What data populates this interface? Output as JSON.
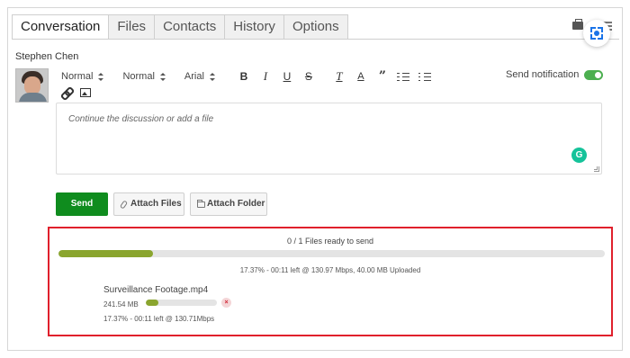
{
  "tabs": [
    "Conversation",
    "Files",
    "Contacts",
    "History",
    "Options"
  ],
  "active_tab": "Conversation",
  "user": {
    "name": "Stephen Chen"
  },
  "toolbar": {
    "heading_select": "Normal",
    "size_select": "Normal",
    "font_select": "Arial",
    "bold": "B",
    "italic": "I",
    "underline": "U",
    "strike": "S",
    "clear_format": "T",
    "text_color": "A",
    "quote": "”"
  },
  "send_notification": {
    "label": "Send notification",
    "enabled": true,
    "color": "#4caf50"
  },
  "editor": {
    "placeholder": "Continue the discussion or add a file",
    "grammarly_badge": "G"
  },
  "buttons": {
    "send": "Send",
    "attach_files": "Attach Files",
    "attach_folder": "Attach Folder"
  },
  "upload": {
    "status": "0 / 1 Files ready to send",
    "progress_fraction": 0.1737,
    "stats": "17.37% - 00:11 left @ 130.97 Mbps, 40.00 MB Uploaded",
    "border_color": "#e0202c",
    "bar_color": "#8aa52e",
    "file": {
      "name": "Surveillance Footage.mp4",
      "size": "241.54 MB",
      "progress_fraction": 0.1737,
      "cancel": "×",
      "stats": "17.37% - 00:11 left @ 130.71Mbps"
    }
  },
  "colors": {
    "send_button": "#0f8c1e",
    "grammarly": "#15c39a",
    "scan_accent": "#1a73e8"
  }
}
